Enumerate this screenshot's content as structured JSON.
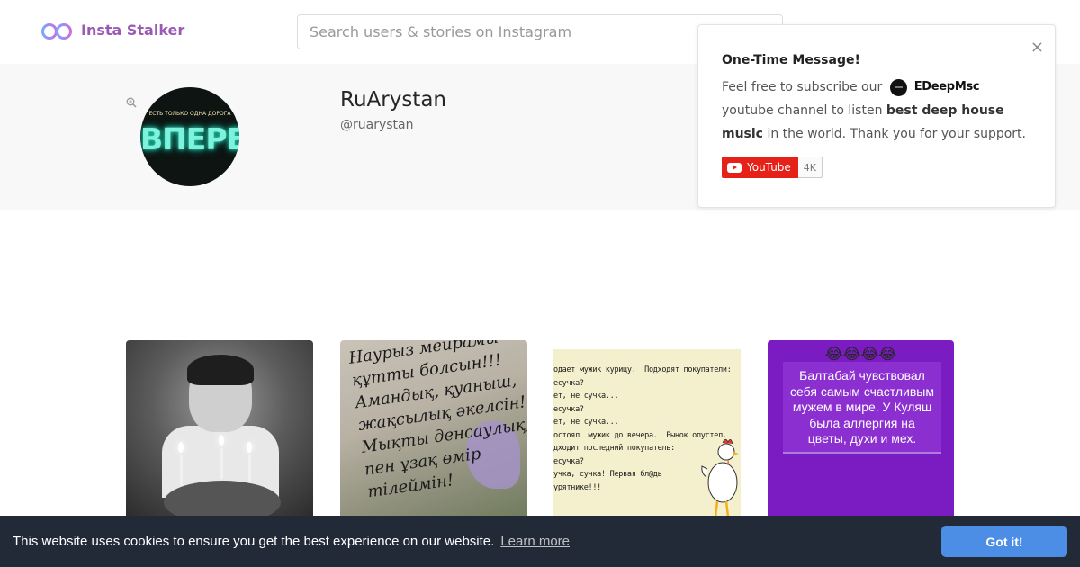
{
  "header": {
    "logo_text": "Insta Stalker",
    "logo_icon": "infinity-glasses-icon",
    "search_placeholder": "Search users & stories on Instagram",
    "search_value": ""
  },
  "profile": {
    "name": "RuArystan",
    "handle": "@ruarystan",
    "avatar_small_text": "ЕСТЬ ТОЛЬКО ОДНА ДОРОГА",
    "avatar_big_text": "ВПЕРЕД",
    "zoom_icon": "zoom-in-icon"
  },
  "popup": {
    "title": "One-Time Message!",
    "body_start": "Feel free to subscribe our",
    "brand_name": "EDeepMsc",
    "body_mid": "youtube channel to listen",
    "body_bold": "best deep house music",
    "body_end": "in the world. Thank you for your support.",
    "close_label": "×",
    "youtube_label": "YouTube",
    "youtube_count": "4K"
  },
  "posts": [
    {
      "kind": "photo",
      "description_icon": "birthday-photo"
    },
    {
      "kind": "text-image",
      "text": "Наурыз мейрамы\nқұтты болсын!!!\nАмандық, қуаныш,\nжақсылық әкелсін!\nМықты денсаулық,\nпен ұзақ өмір\nтілеймін!"
    },
    {
      "kind": "text-image",
      "text": "одает мужик курицу.  Подходят покупатели:\nесучка?\nет, не сучка...\nесучка?\nет, не сучка...\nостоял  мужик до вечера.  Рынок опустел.\nдходит последний покупатель:\nесучка?\nучка, сучка! Первая бл@дь\nурятнике!!!"
    },
    {
      "kind": "text-image",
      "emoji": "😂😂😂😂",
      "text": "Балтабай чувствовал\nсебя самым счастливым\nмужем в мире. У Куляш\nбыла аллергия на\nцветы, духи и мех."
    }
  ],
  "cookie": {
    "message": "This website uses cookies to ensure you get the best experience on our website.",
    "link_text": "Learn more",
    "button_label": "Got it!"
  },
  "colors": {
    "brand": "#9b59b6",
    "cookie_bg": "#222937",
    "cookie_button": "#4c8de6",
    "youtube_red": "#e62117"
  }
}
